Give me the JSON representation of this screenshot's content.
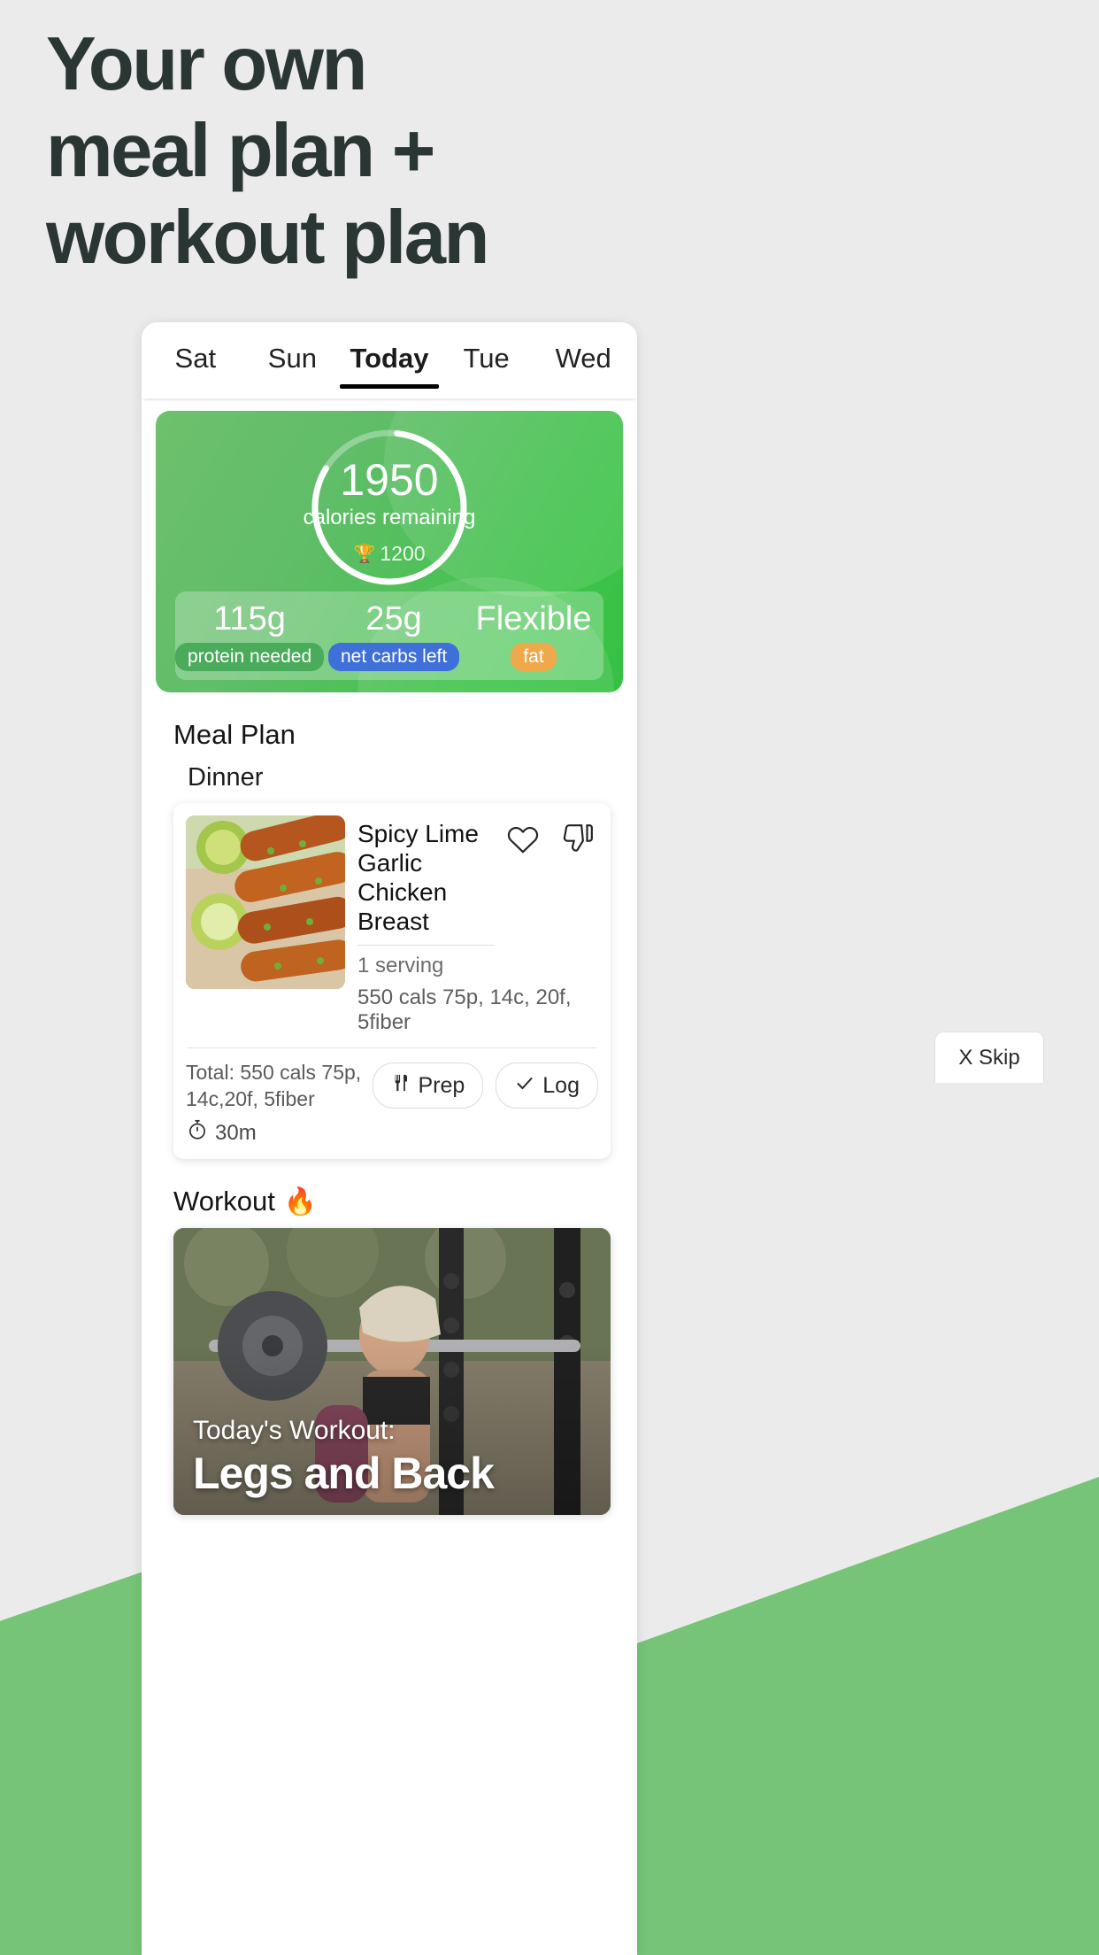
{
  "headline": "Your own\nmeal plan +\nworkout plan",
  "colors": {
    "headline": "#2a3634",
    "page_bg": "#ebebeb",
    "accent_green": "#76c477",
    "card_green_start": "#6ec06d",
    "card_green_end": "#36c144",
    "protein_pill": "#4aab5b",
    "carbs_pill": "#3f6fd8",
    "fat_pill": "#efa94a"
  },
  "tabs": [
    {
      "label": "Sat",
      "active": false
    },
    {
      "label": "Sun",
      "active": false
    },
    {
      "label": "Today",
      "active": true
    },
    {
      "label": "Tue",
      "active": false
    },
    {
      "label": "Wed",
      "active": false
    }
  ],
  "calorie_card": {
    "calories_remaining": "1950",
    "calories_label": "calories remaining",
    "goal_icon": "trophy-icon",
    "goal_value": "1200",
    "ring_progress_percent": 82,
    "macros": [
      {
        "value": "115g",
        "label": "protein needed",
        "pill_color": "#4aab5b"
      },
      {
        "value": "25g",
        "label": "net carbs left",
        "pill_color": "#3f6fd8"
      },
      {
        "value": "Flexible",
        "label": "fat",
        "pill_color": "#efa94a"
      }
    ]
  },
  "meal_plan": {
    "section_title": "Meal Plan",
    "meal_label": "Dinner",
    "skip_label": "X Skip",
    "item": {
      "name": "Spicy Lime Garlic Chicken Breast",
      "serving": "1 serving",
      "macros": "550 cals 75p, 14c, 20f, 5fiber",
      "favorite_icon": "heart-icon",
      "dislike_icon": "thumbs-down-icon",
      "total": "Total: 550 cals 75p, 14c,20f, 5fiber",
      "time_icon": "stopwatch-icon",
      "time": "30m",
      "prep_label": "Prep",
      "prep_icon": "cutlery-icon",
      "log_label": "Log",
      "log_icon": "check-icon"
    }
  },
  "workout": {
    "section_title": "Workout",
    "section_icon": "flame-icon",
    "overline": "Today's Workout:",
    "title": "Legs and Back"
  }
}
